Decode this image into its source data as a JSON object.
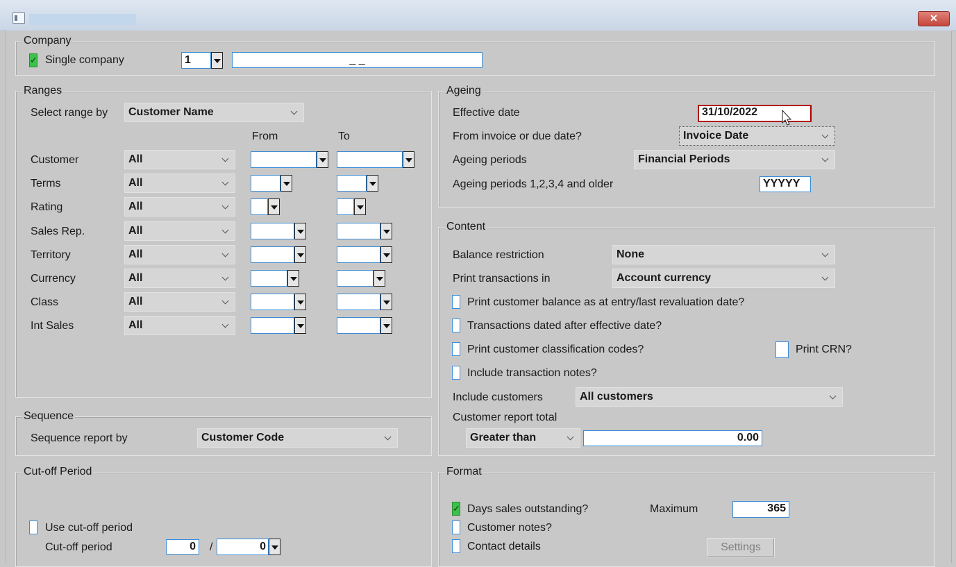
{
  "window": {
    "close_label": "✕"
  },
  "company": {
    "legend": "Company",
    "single_company_label": "Single company",
    "company_number": "1",
    "company_name": "_ _"
  },
  "ranges": {
    "legend": "Ranges",
    "select_range_label": "Select range by",
    "select_range_value": "Customer Name",
    "from_header": "From",
    "to_header": "To",
    "rows": [
      {
        "label": "Customer",
        "value": "All"
      },
      {
        "label": "Terms",
        "value": "All"
      },
      {
        "label": "Rating",
        "value": "All"
      },
      {
        "label": "Sales Rep.",
        "value": "All"
      },
      {
        "label": "Territory",
        "value": "All"
      },
      {
        "label": "Currency",
        "value": "All"
      },
      {
        "label": "Class",
        "value": "All"
      },
      {
        "label": "Int Sales",
        "value": "All"
      }
    ]
  },
  "ageing": {
    "legend": "Ageing",
    "effective_date_label": "Effective date",
    "effective_date_value": "31/10/2022",
    "invoice_due_label": "From invoice or due date?",
    "invoice_due_value": "Invoice Date",
    "periods_label": "Ageing periods",
    "periods_value": "Financial Periods",
    "periods_older_label": "Ageing periods 1,2,3,4 and older",
    "periods_older_value": "YYYYY"
  },
  "content": {
    "legend": "Content",
    "balance_label": "Balance restriction",
    "balance_value": "None",
    "print_in_label": "Print transactions in",
    "print_in_value": "Account currency",
    "chk_balance": "Print customer balance as at entry/last revaluation date?",
    "chk_after": "Transactions dated after effective date?",
    "chk_class": "Print customer classification codes?",
    "chk_crn": "Print CRN?",
    "chk_notes": "Include transaction notes?",
    "include_label": "Include customers",
    "include_value": "All customers",
    "report_total_label": "Customer report total",
    "total_op": "Greater than",
    "total_value": "0.00"
  },
  "sequence": {
    "legend": "Sequence",
    "label": "Sequence report by",
    "value": "Customer Code"
  },
  "cutoff": {
    "legend": "Cut-off Period",
    "use_label": "Use cut-off period",
    "period_label": "Cut-off period",
    "period_value": "0",
    "slash": "/",
    "year_value": "0"
  },
  "format": {
    "legend": "Format",
    "dso_label": "Days sales outstanding?",
    "max_label": "Maximum",
    "max_value": "365",
    "notes_label": "Customer notes?",
    "contact_label": "Contact details",
    "settings_label": "Settings"
  }
}
